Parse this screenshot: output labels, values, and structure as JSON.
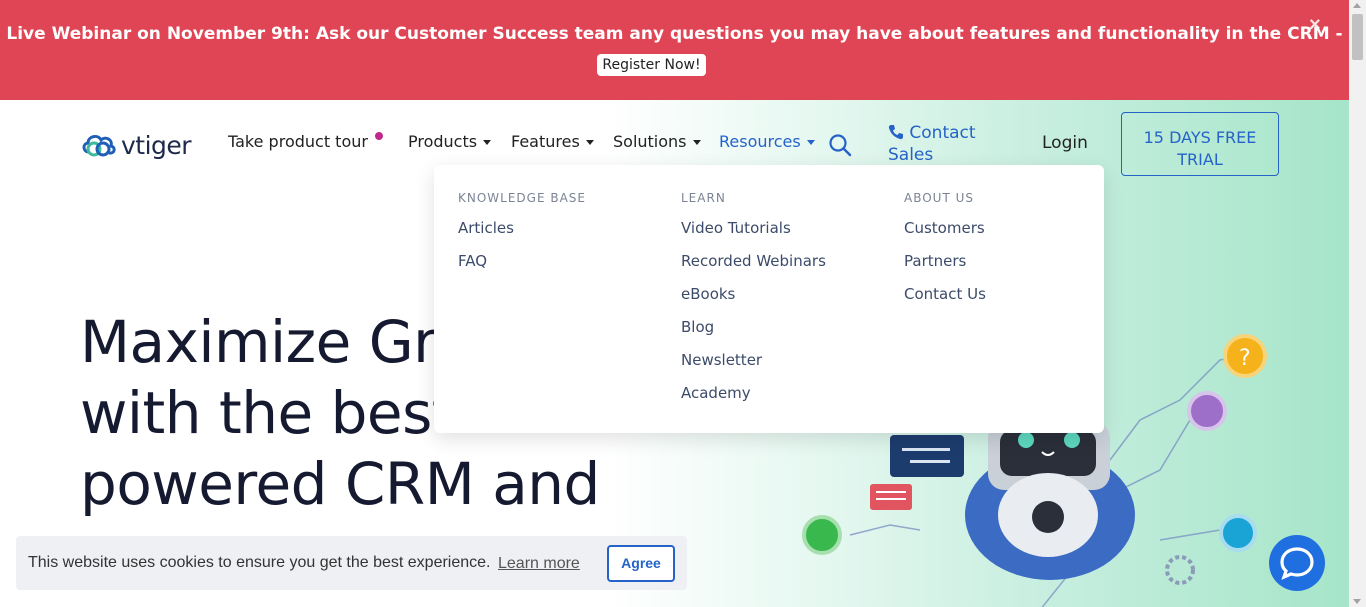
{
  "banner": {
    "text": "Live Webinar on November 9th: Ask our Customer Success team any questions you may have about features and functionality in the CRM -",
    "button": "Register Now!",
    "close": "×"
  },
  "logo": {
    "text": "vtiger"
  },
  "nav": {
    "tour": "Take product tour",
    "products": "Products",
    "features": "Features",
    "solutions": "Solutions",
    "resources": "Resources",
    "contact_line1": "Contact",
    "contact_line2": "Sales",
    "login": "Login",
    "trial_line1": "15 DAYS FREE",
    "trial_line2": "TRIAL"
  },
  "hero": {
    "line1": "Maximize Gro",
    "line2": "with the best AI-",
    "line3": "powered CRM and"
  },
  "dropdown": {
    "columns": [
      {
        "heading": "KNOWLEDGE BASE",
        "links": [
          "Articles",
          "FAQ"
        ]
      },
      {
        "heading": "LEARN",
        "links": [
          "Video Tutorials",
          "Recorded Webinars",
          "eBooks",
          "Blog",
          "Newsletter",
          "Academy"
        ]
      },
      {
        "heading": "ABOUT US",
        "links": [
          "Customers",
          "Partners",
          "Contact Us"
        ]
      }
    ]
  },
  "cookie": {
    "text": "This website uses cookies to ensure you get the best experience.",
    "link": "Learn more",
    "button": "Agree"
  },
  "colors": {
    "banner": "#e04555",
    "accent": "#2563c9",
    "hero_text": "#151a30"
  },
  "icons": [
    "close-icon",
    "search-icon",
    "phone-icon",
    "chat-icon",
    "robot-illustration"
  ]
}
